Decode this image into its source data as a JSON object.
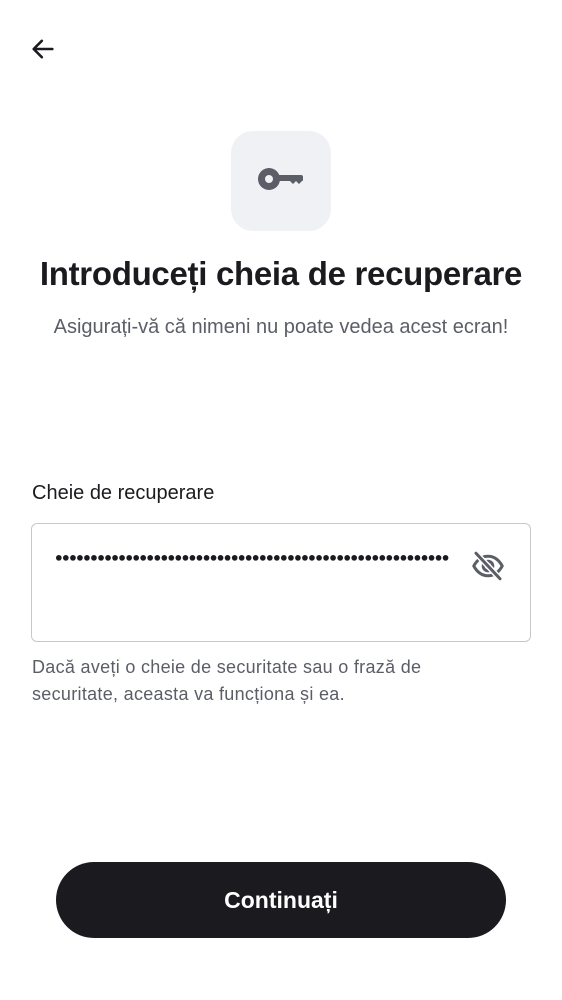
{
  "icons": {
    "back": "arrow-back-icon",
    "key": "key-icon",
    "visibility": "eye-off-icon"
  },
  "header": {
    "title": "Introduceți cheia de recuperare",
    "subtitle": "Asigurați-vă că nimeni nu poate vedea acest ecran!"
  },
  "recovery_field": {
    "label": "Cheie de recuperare",
    "value": "••••••••••••••••••••••••••••••••••••••••••••••••••••••••",
    "helper_text": "Dacă aveți o cheie de securitate sau o frază de securitate, aceasta va funcționa și ea."
  },
  "actions": {
    "continue_label": "Continuați"
  },
  "colors": {
    "primary": "#1b1b1f",
    "tile_background": "#f0f1f5",
    "secondary_text": "#5b5e66",
    "border": "#c7c8cd",
    "icon_gray": "#5b5e66"
  }
}
